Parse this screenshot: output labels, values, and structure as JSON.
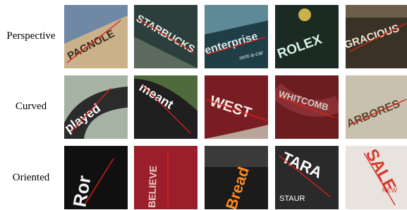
{
  "rows": [
    {
      "label": "Perspective",
      "samples": [
        {
          "word": "PAGNOLE",
          "bg": "#a89a80",
          "fg": "#3b2a1c"
        },
        {
          "word": "STARBUCKS",
          "bg": "#2c3f3c",
          "fg": "#e8ece6"
        },
        {
          "word": "enterprise",
          "bg": "#1f3e46",
          "fg": "#dfe7ea",
          "subtext": "rent-a-car"
        },
        {
          "word": "ROLEX",
          "bg": "#1c2a24",
          "fg": "#d7f2e6"
        },
        {
          "word": "GRACIOUS",
          "bg": "#3a3226",
          "fg": "#efe5cf"
        }
      ]
    },
    {
      "label": "Curved",
      "samples": [
        {
          "word": "played",
          "bg": "#2b2b2b",
          "fg": "#ffffff"
        },
        {
          "word": "meant",
          "bg": "#1f1f1f",
          "fg": "#ffffff"
        },
        {
          "word": "WEST",
          "bg": "#7a1d22",
          "fg": "#f3e9e6"
        },
        {
          "word": "WHITCOMB",
          "bg": "#6b1d1f",
          "fg": "#d8c8c2"
        },
        {
          "word": "ARBORES",
          "bg": "#c7c1ad",
          "fg": "#5b4633"
        }
      ]
    },
    {
      "label": "Oriented",
      "samples": [
        {
          "word": "Ror",
          "bg": "#101010",
          "fg": "#f2f2f2"
        },
        {
          "word": "BELIEVE",
          "bg": "#9b1f2a",
          "fg": "#e7c9c6"
        },
        {
          "word": "Bread",
          "bg": "#1b1b1b",
          "fg": "#ff8a1e"
        },
        {
          "word": "TARA",
          "bg": "#2a2a2a",
          "fg": "#ffffff",
          "subtext": "STAUR"
        },
        {
          "word": "SALE",
          "bg": "#e9e3df",
          "fg": "#d93a2c",
          "subtext": "NEW"
        }
      ]
    }
  ]
}
